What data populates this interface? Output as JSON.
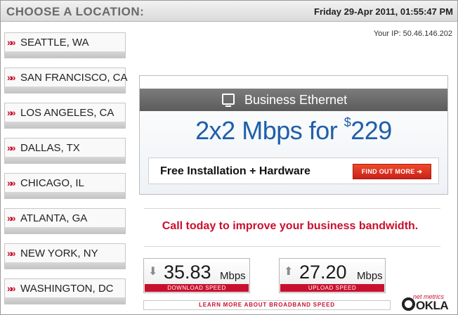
{
  "header": {
    "title": "CHOOSE A LOCATION:",
    "datetime": "Friday 29-Apr 2011, 01:55:47 PM"
  },
  "ip": "Your IP: 50.46.146.202",
  "locations": [
    {
      "label": "SEATTLE, WA"
    },
    {
      "label": "SAN FRANCISCO, CA"
    },
    {
      "label": "LOS ANGELES, CA"
    },
    {
      "label": "DALLAS, TX"
    },
    {
      "label": "CHICAGO, IL"
    },
    {
      "label": "ATLANTA, GA"
    },
    {
      "label": "NEW YORK, NY"
    },
    {
      "label": "WASHINGTON, DC"
    }
  ],
  "location_marker": "»»",
  "ad": {
    "header": "Business Ethernet",
    "headline_prefix": "2x2  Mbps for ",
    "currency": "$",
    "price": "229",
    "subline": "Free Installation + Hardware",
    "cta": "FIND OUT MORE ➔"
  },
  "call_text": "Call today to improve your business bandwidth.",
  "download": {
    "value": "35.83",
    "unit": "Mbps",
    "caption": "DOWNLOAD SPEED",
    "arrow": "⬇"
  },
  "upload": {
    "value": "27.20",
    "unit": "Mbps",
    "caption": "UPLOAD SPEED",
    "arrow": "⬆"
  },
  "learn_more": "LEARN MORE ABOUT BROADBAND SPEED",
  "brand": {
    "small": "net metrics",
    "word": "OKLA"
  },
  "colors": {
    "accent_red": "#c8102e",
    "headline_blue": "#1f5fa8"
  }
}
